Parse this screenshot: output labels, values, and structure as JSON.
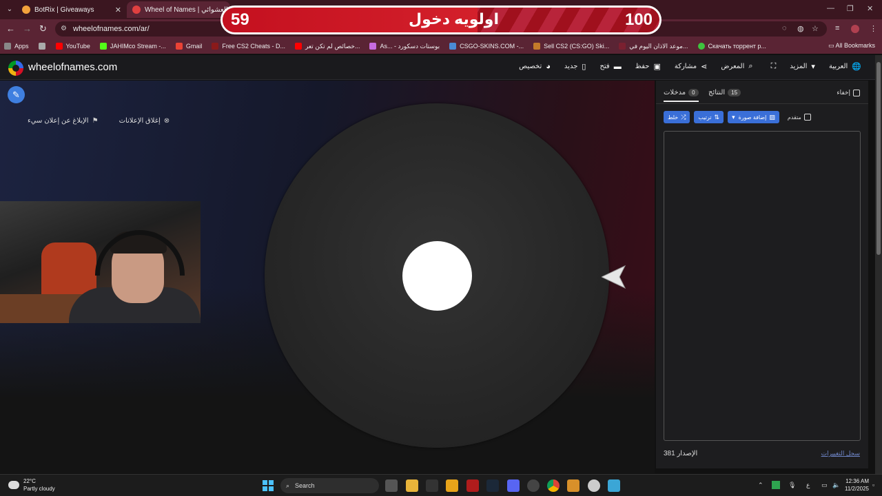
{
  "browser": {
    "tabs": [
      {
        "title": "BotRix | Giveaways",
        "favicon_color": "#f2a23c"
      },
      {
        "title": "Wheel of Names | اسم العشوائي",
        "favicon_color": "#e04040"
      }
    ],
    "url": "wheelofnames.com/ar/",
    "bookmarks": [
      {
        "label": "Apps",
        "color": "#888"
      },
      {
        "label": "YouTube",
        "color": "#ff0000"
      },
      {
        "label": "JAHIMco Stream -...",
        "color": "#53fc18"
      },
      {
        "label": "Gmail",
        "color": "#ea4335"
      },
      {
        "label": "Free CS2 Cheats - D...",
        "color": "#8a1a1a"
      },
      {
        "label": "خصائص لم تكن تعر...",
        "color": "#ff0000"
      },
      {
        "label": "As... - بوستات دسكورد",
        "color": "#c86be0"
      },
      {
        "label": "CSGO-SKINS.COM -...",
        "color": "#4a8ad6"
      },
      {
        "label": "Sell CS2 (CS:GO) Ski...",
        "color": "#c47a2a"
      },
      {
        "label": "موعد الاذان اليوم في...",
        "color": "#7a2030"
      },
      {
        "label": "Скачать торрент р...",
        "color": "#3ec43e"
      }
    ],
    "all_bookmarks": "All Bookmarks"
  },
  "banner": {
    "left_number": "59",
    "title": "اولويه دخول",
    "right_number": "100"
  },
  "site": {
    "logo": "wheelofnames.com",
    "menu": [
      {
        "label": "العربية",
        "icon": "globe-icon",
        "glyph": "🌐"
      },
      {
        "label": "المزيد",
        "icon": "caret-down-icon",
        "glyph": "▾"
      },
      {
        "label": "",
        "icon": "fullscreen-icon",
        "glyph": "⛶"
      },
      {
        "label": "المعرض",
        "icon": "search-icon",
        "glyph": "⌕"
      },
      {
        "label": "مشاركة",
        "icon": "share-icon",
        "glyph": "⋖"
      },
      {
        "label": "حفظ",
        "icon": "save-icon",
        "glyph": "▣"
      },
      {
        "label": "فتح",
        "icon": "folder-icon",
        "glyph": "▬"
      },
      {
        "label": "جديد",
        "icon": "new-file-icon",
        "glyph": "▯"
      },
      {
        "label": "تخصيص",
        "icon": "palette-icon",
        "glyph": "◕"
      }
    ],
    "ad_links": {
      "close_ads": "إغلاق الإعلانات",
      "report_ad": "الإبلاغ عن إعلان سيء"
    }
  },
  "panel": {
    "hide_label": "إخفاء",
    "tabs": {
      "entries_label": "مدخلات",
      "entries_count": "0",
      "results_label": "النتائج",
      "results_count": "15"
    },
    "buttons": {
      "shuffle": "خلط",
      "sort": "ترتيب",
      "add_image": "إضافة صورة"
    },
    "advanced_label": "متقدم",
    "version": "الإصدار 381",
    "changelog": "سجل التغييرات"
  },
  "taskbar": {
    "temperature": "22°C",
    "weather": "Partly cloudy",
    "search_placeholder": "Search",
    "language": "ع",
    "time": "12:36 AM",
    "date": "11/2/2025"
  },
  "colors": {
    "accent": "#3a6fd8",
    "banner_red": "#c4101f",
    "panel_bg": "#1d1d1f"
  }
}
